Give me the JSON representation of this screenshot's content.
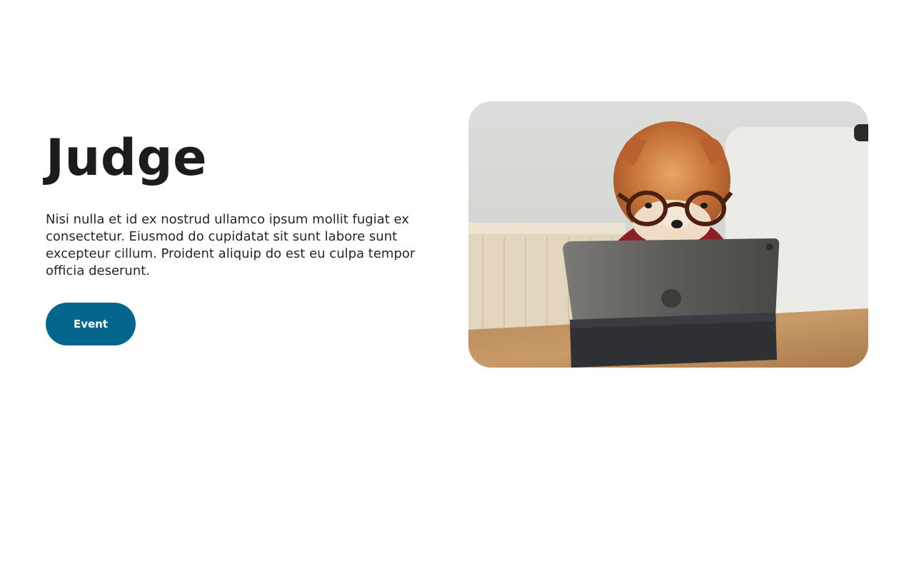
{
  "hero": {
    "title": "Judge",
    "body": "Nisi nulla et id ex nostrud ullamco ipsum mollit fugiat ex consectetur. Eiusmod do cupidatat sit sunt labore sunt excepteur cillum. Proident aliquip do est eu culpa tempor officia deserunt.",
    "button_label": "Event"
  },
  "image": {
    "subject": "pomeranian dog wearing glasses looking at a tablet"
  },
  "colors": {
    "accent": "#05668d",
    "text": "#1c1c1c"
  }
}
